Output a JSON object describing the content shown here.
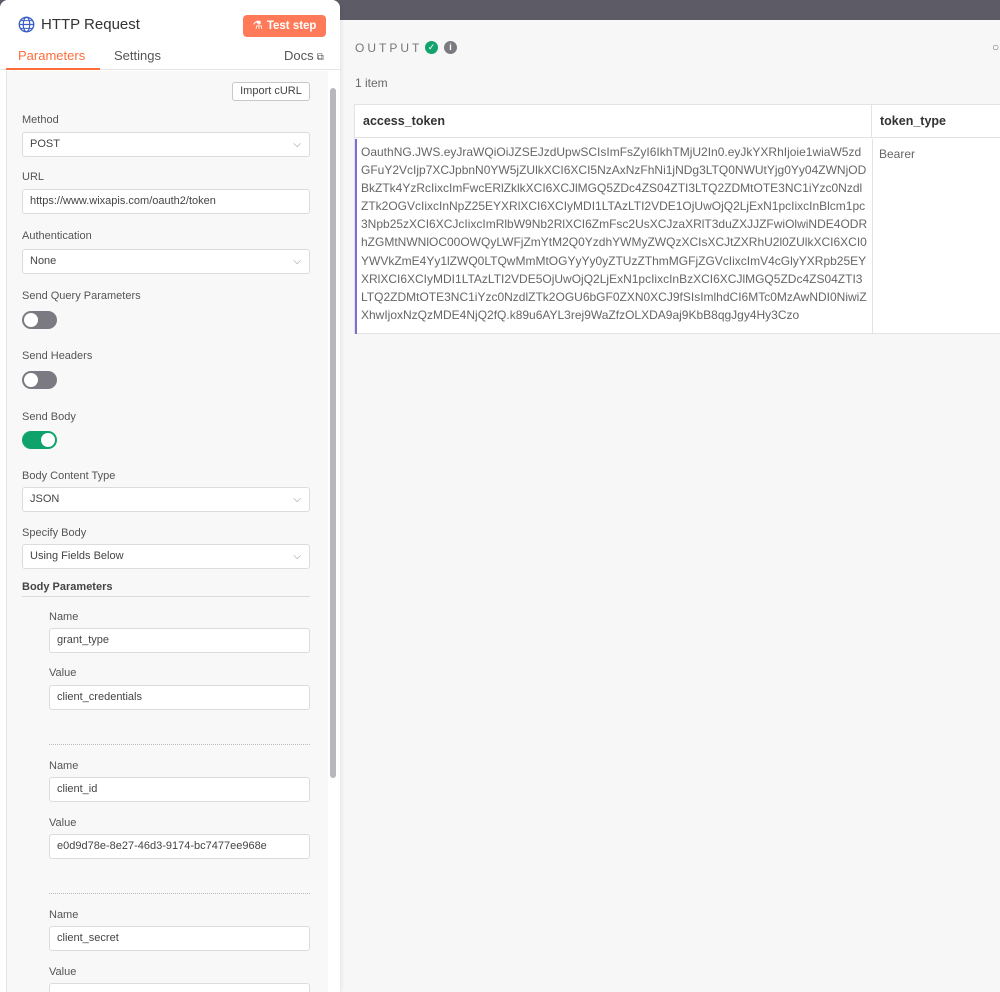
{
  "panel": {
    "title": "HTTP Request",
    "test_step_label": "Test step",
    "tabs": {
      "parameters": "Parameters",
      "settings": "Settings",
      "docs": "Docs"
    },
    "import_curl_label": "Import cURL"
  },
  "form": {
    "method_label": "Method",
    "method_value": "POST",
    "url_label": "URL",
    "url_value": "https://www.wixapis.com/oauth2/token",
    "auth_label": "Authentication",
    "auth_value": "None",
    "send_query_label": "Send Query Parameters",
    "send_query_on": false,
    "send_headers_label": "Send Headers",
    "send_headers_on": false,
    "send_body_label": "Send Body",
    "send_body_on": true,
    "body_content_type_label": "Body Content Type",
    "body_content_type_value": "JSON",
    "specify_body_label": "Specify Body",
    "specify_body_value": "Using Fields Below",
    "body_params_label": "Body Parameters",
    "params": [
      {
        "name_label": "Name",
        "name": "grant_type",
        "value_label": "Value",
        "value": "client_credentials"
      },
      {
        "name_label": "Name",
        "name": "client_id",
        "value_label": "Value",
        "value": "e0d9d78e-8e27-46d3-9174-bc7477ee968e"
      },
      {
        "name_label": "Name",
        "name": "client_secret",
        "value_label": "Value",
        "value": ""
      }
    ]
  },
  "output": {
    "title": "OUTPUT",
    "item_count": "1 item",
    "columns": [
      "access_token",
      "token_type"
    ],
    "row": {
      "access_token": "OauthNG.JWS.eyJraWQiOiJZSEJzdUpwSCIsImFsZyI6IkhTMjU2In0.eyJkYXRhIjoie1wiaW5zdGFuY2VcIjp7XCJpbnN0YW5jZUlkXCI6XCI5NzAxNzFhNi1jNDg3LTQ0NWUtYjg0Yy04ZWNjODBkZTk4YzRcIixcImFwcERlZklkXCI6XCJlMGQ5ZDc4ZS04ZTI3LTQ2ZDMtOTE3NC1iYzc0NzdlZTk2OGVcIixcInNpZ25EYXRlXCI6XCIyMDI1LTAzLTI2VDE1OjUwOjQ2LjExN1pcIixcInBlcm1pc3Npb25zXCI6XCJcIixcImRlbW9Nb2RlXCI6ZmFsc2UsXCJzaXRlT3duZXJJZFwiOlwiNDE4ODRhZGMtNWNlOC00OWQyLWFjZmYtM2Q0YzdhYWMyZWQzXCIsXCJtZXRhU2l0ZUlkXCI6XCI0YWVkZmE4Yy1lZWQ0LTQwMmMtOGYyYy0yZTUzZThmMGFjZGVcIixcImV4cGlyYXRpb25EYXRlXCI6XCIyMDI1LTAzLTI2VDE5OjUwOjQ2LjExN1pcIixcInBzXCI6XCJlMGQ5ZDc4ZS04ZTI3LTQ2ZDMtOTE3NC1iYzc0NzdlZTk2OGU6bGF0ZXN0XCJ9fSIsImlhdCI6MTc0MzAwNDI0NiwiZXhwIjoxNzQzMDE4NjQ2fQ.k89u6AYL3rej9WaZfzOLXDA9aj9KbB8qgJgy4Hy3Czo",
      "token_type": "Bearer"
    }
  },
  "colors": {
    "accent": "#ff6d3d",
    "test_button": "#ff7a59",
    "toggle_on": "#0ea36b",
    "toggle_off": "#7b7a82",
    "success": "#13a36e",
    "row_marker": "#7c6fcf"
  },
  "icons": {
    "title": "globe-icon",
    "test_step": "flask-icon",
    "docs": "external-link-icon",
    "select": "chevron-down-icon",
    "output_status": "check-circle-icon",
    "output_info": "info-icon",
    "output_search": "search-icon"
  }
}
